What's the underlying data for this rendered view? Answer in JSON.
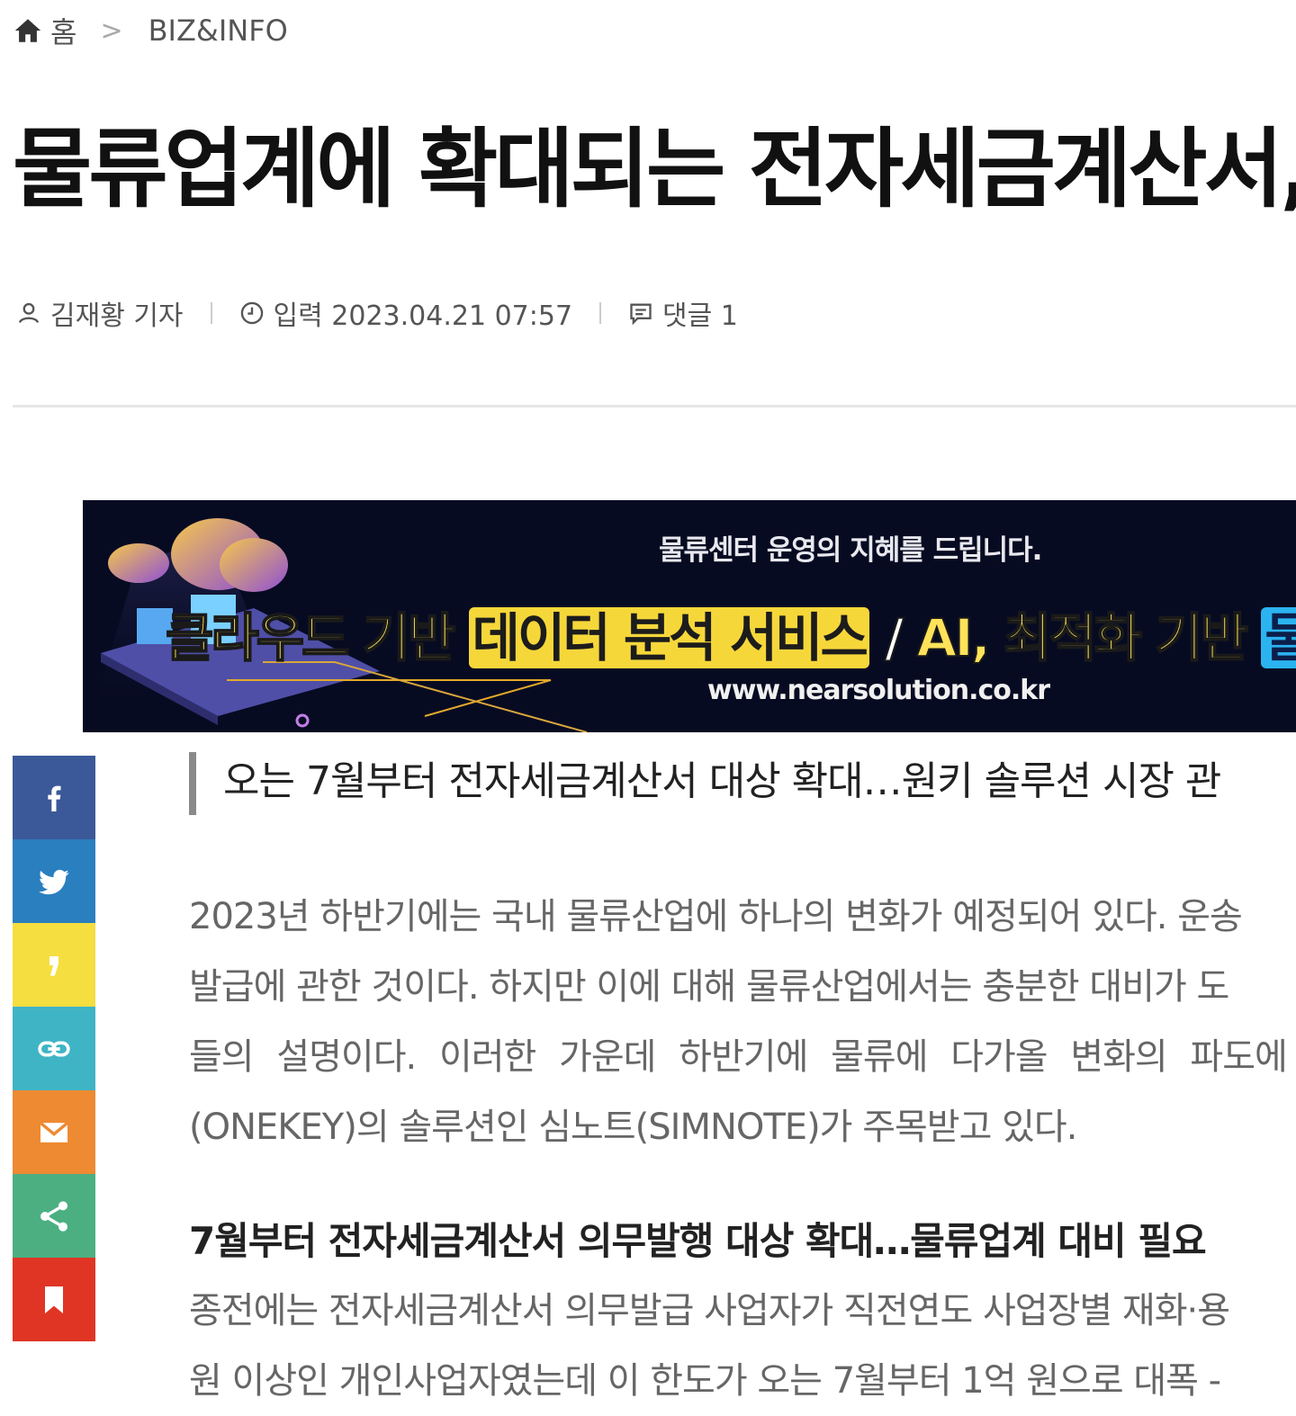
{
  "breadcrumb": {
    "home_label": "홈",
    "separator": ">",
    "section": "BIZ&INFO"
  },
  "article": {
    "title": "물류업계에 확대되는 전자세금계산서,",
    "meta": {
      "author": "김재황 기자",
      "date": "입력 2023.04.21 07:57",
      "comments": "댓글 1"
    },
    "subheading": "오는 7월부터 전자세금계산서 대상 확대…원키 솔루션 시장 관",
    "paragraph1": [
      "2023년 하반기에는 국내 물류산업에 하나의 변화가 예정되어 있다. 운송",
      "발급에 관한 것이다. 하지만 이에 대해 물류산업에서는 충분한 대비가 도",
      "들의 설명이다. 이러한 가운데 하반기에 물류에 다가올 변화의 파도에",
      "(ONEKEY)의 솔루션인 심노트(SIMNOTE)가 주목받고 있다."
    ],
    "section_title": "7월부터 전자세금계산서 의무발행 대상 확대…물류업계 대비 필요",
    "paragraph2": [
      "종전에는 전자세금계산서 의무발급 사업자가 직전연도 사업장별 재화·용",
      "원 이상인 개인사업자였는데 이 한도가 오는 7월부터 1억 원으로 대폭 -"
    ]
  },
  "banner": {
    "tagline": "물류센터 운영의 지혜를 드립니다.",
    "headline_part1": "클라우드 기반 ",
    "headline_highlight1": "데이터 분석 서비스",
    "headline_sep": " / ",
    "headline_part2": "AI, 최적화 기반 ",
    "headline_highlight2": "물류기",
    "url": "www.nearsolution.co.kr"
  },
  "share_buttons": [
    {
      "name": "facebook",
      "icon": "facebook-icon",
      "color": "#3b5998"
    },
    {
      "name": "twitter",
      "icon": "twitter-icon",
      "color": "#2a7fbf"
    },
    {
      "name": "kakaostory",
      "icon": "kakaostory-icon",
      "color": "#f5de3f"
    },
    {
      "name": "link",
      "icon": "link-icon",
      "color": "#3fb4c5"
    },
    {
      "name": "email",
      "icon": "mail-icon",
      "color": "#ee8a32"
    },
    {
      "name": "share",
      "icon": "share-icon",
      "color": "#4caf82"
    },
    {
      "name": "bookmark",
      "icon": "bookmark-icon",
      "color": "#e03524"
    }
  ]
}
